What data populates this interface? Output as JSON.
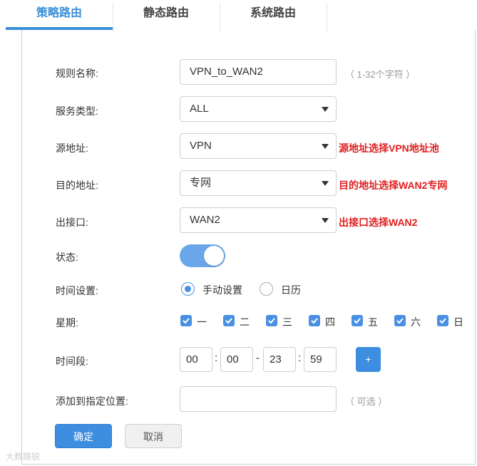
{
  "tabs": [
    {
      "label": "策略路由",
      "active": true
    },
    {
      "label": "静态路由",
      "active": false
    },
    {
      "label": "系统路由",
      "active": false
    }
  ],
  "form": {
    "rule_name": {
      "label": "规则名称:",
      "value": "VPN_to_WAN2",
      "hint": "（ 1-32个字符 ）"
    },
    "service_type": {
      "label": "服务类型:",
      "value": "ALL"
    },
    "source": {
      "label": "源地址:",
      "value": "VPN",
      "note": "源地址选择VPN地址池"
    },
    "destination": {
      "label": "目的地址:",
      "value": "专网",
      "note": "目的地址选择WAN2专网"
    },
    "egress": {
      "label": "出接口:",
      "value": "WAN2",
      "note": "出接口选择WAN2"
    },
    "status": {
      "label": "状态:",
      "enabled": true
    },
    "time_setting": {
      "label": "时间设置:",
      "options": [
        {
          "label": "手动设置",
          "selected": true
        },
        {
          "label": "日历",
          "selected": false
        }
      ]
    },
    "weekdays": {
      "label": "星期:",
      "days": [
        {
          "label": "一",
          "checked": true
        },
        {
          "label": "二",
          "checked": true
        },
        {
          "label": "三",
          "checked": true
        },
        {
          "label": "四",
          "checked": true
        },
        {
          "label": "五",
          "checked": true
        },
        {
          "label": "六",
          "checked": true
        },
        {
          "label": "日",
          "checked": true
        }
      ]
    },
    "time_range": {
      "label": "时间段:",
      "start_hour": "00",
      "start_min": "00",
      "end_hour": "23",
      "end_min": "59",
      "colon": ":",
      "dash": "-",
      "add_label": "+"
    },
    "position": {
      "label": "添加到指定位置:",
      "value": "",
      "hint": "（ 可选 ）"
    }
  },
  "buttons": {
    "ok": "确定",
    "cancel": "取消"
  },
  "watermark": "大数路锐",
  "colors": {
    "accent": "#3d8ee0",
    "note": "#e02020"
  }
}
